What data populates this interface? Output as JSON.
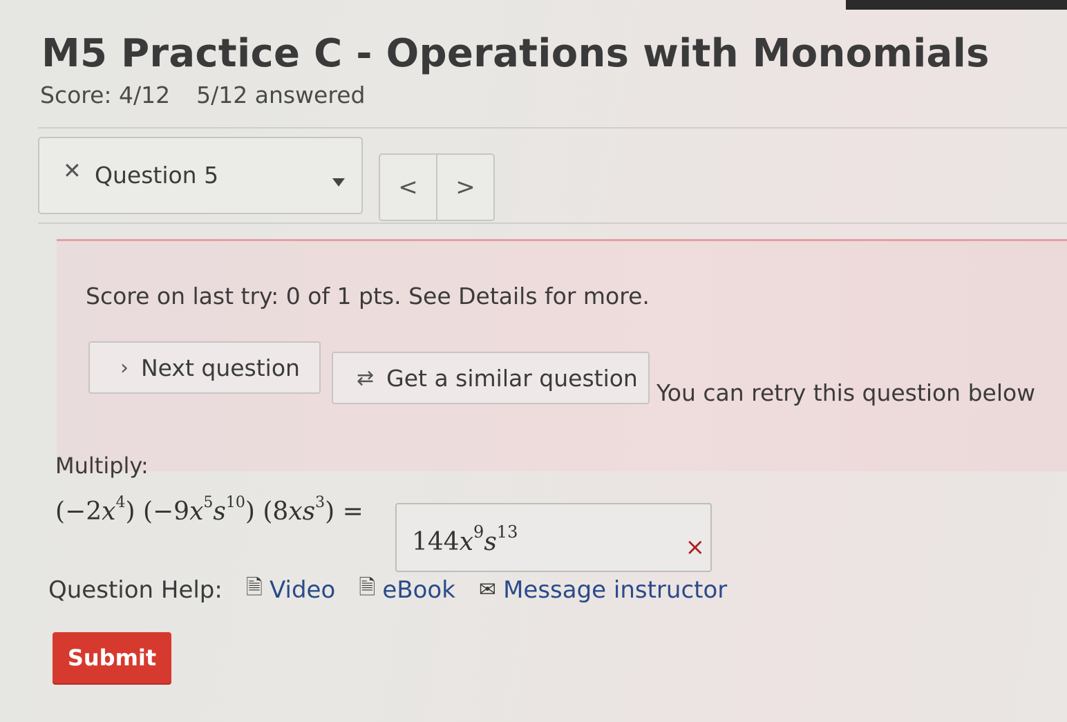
{
  "header": {
    "title": "M5 Practice C - Operations with Monomials",
    "score": "Score: 4/12",
    "answered": "5/12 answered"
  },
  "question_nav": {
    "current_label": "Question 5",
    "close_icon": "close-icon",
    "prev_symbol": "<",
    "next_symbol": ">"
  },
  "alert": {
    "message": "Score on last try: 0 of 1 pts. See Details for more.",
    "next_question_label": "Next question",
    "similar_question_label": "Get a similar question",
    "retry_text": "You can retry this question below",
    "colors": {
      "border": "#e3a0a3",
      "background": "#efdcdc"
    }
  },
  "question": {
    "instruction": "Multiply:",
    "factors": [
      {
        "open": "(−2",
        "var1": "x",
        "exp1": "4",
        "var2": "",
        "exp2": "",
        "close": ")"
      },
      {
        "open": "(−9",
        "var1": "x",
        "exp1": "5",
        "var2": "s",
        "exp2": "10",
        "close": ")"
      },
      {
        "open": "(8",
        "var1": "x",
        "exp1": "",
        "var2": "s",
        "exp2": "3",
        "close": ")"
      }
    ],
    "equals": "=",
    "answer": {
      "coef": "144",
      "var1": "x",
      "exp1": "9",
      "var2": "s",
      "exp2": "13",
      "status_mark": "×"
    }
  },
  "help": {
    "label": "Question Help:",
    "video": "Video",
    "ebook": "eBook",
    "message": "Message instructor"
  },
  "submit_label": "Submit",
  "colors": {
    "submit": "#d63a2f",
    "link": "#2a4a8a",
    "wrong": "#aa2222"
  }
}
